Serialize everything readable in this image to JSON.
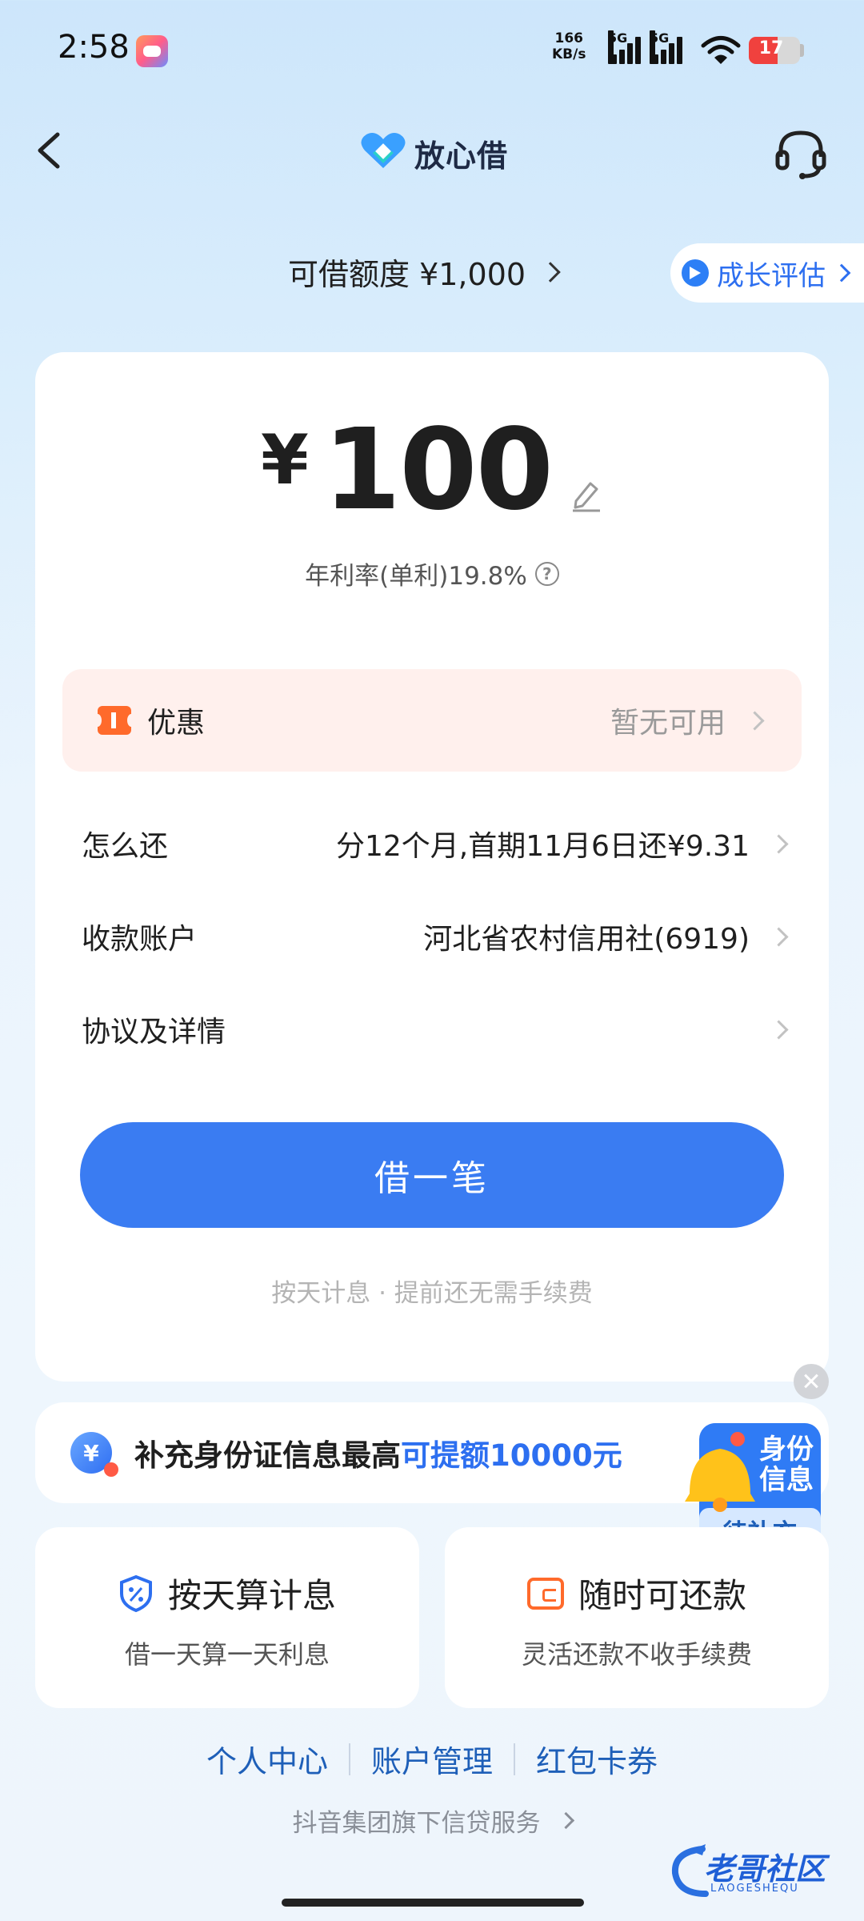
{
  "status_bar": {
    "time": "2:58",
    "net_speed_value": "166",
    "net_speed_unit": "KB/s",
    "signal_label_1": "5G",
    "signal_label_2": "5G",
    "battery": "17"
  },
  "header": {
    "brand_name": "放心借",
    "icons": {
      "back": "back-chevron-icon",
      "logo": "heart-logo-icon",
      "support": "headset-icon"
    }
  },
  "limit": {
    "text": "可借额度 ¥1,000",
    "growth_label": "成长评估"
  },
  "loan": {
    "currency": "¥",
    "amount": "100",
    "rate_text": "年利率(单利)19.8%",
    "help_symbol": "?"
  },
  "promo": {
    "label": "优惠",
    "value": "暂无可用"
  },
  "rows": [
    {
      "key": "怎么还",
      "value": "分12个月,首期11月6日还¥9.31"
    },
    {
      "key": "收款账户",
      "value": "河北省农村信用社(6919)"
    },
    {
      "key": "协议及详情",
      "value": ""
    }
  ],
  "borrow_button": "借一笔",
  "tip": "按天计息 · 提前还无需手续费",
  "id_banner": {
    "coin_symbol": "¥",
    "text_main": "补充身份证信息最高",
    "text_highlight": "可提额10000元",
    "badge_line1": "身份",
    "badge_line2": "信息",
    "badge_status": "待补充"
  },
  "features": [
    {
      "title": "按天算计息",
      "subtitle": "借一天算一天利息",
      "icon": "percent-shield-icon"
    },
    {
      "title": "随时可还款",
      "subtitle": "灵活还款不收手续费",
      "icon": "wallet-icon"
    }
  ],
  "footer": {
    "links": [
      "个人中心",
      "账户管理",
      "红包卡券"
    ],
    "note": "抖音集团旗下信贷服务",
    "watermark_text": "老哥社区",
    "watermark_sub": "LAOGESHEQU"
  },
  "colors": {
    "primary": "#3a7cf2",
    "highlight": "#2d6ff0",
    "promo_bg": "#fff0ed",
    "coupon_orange": "#ff6a2b",
    "link_blue": "#1e5fb8"
  }
}
